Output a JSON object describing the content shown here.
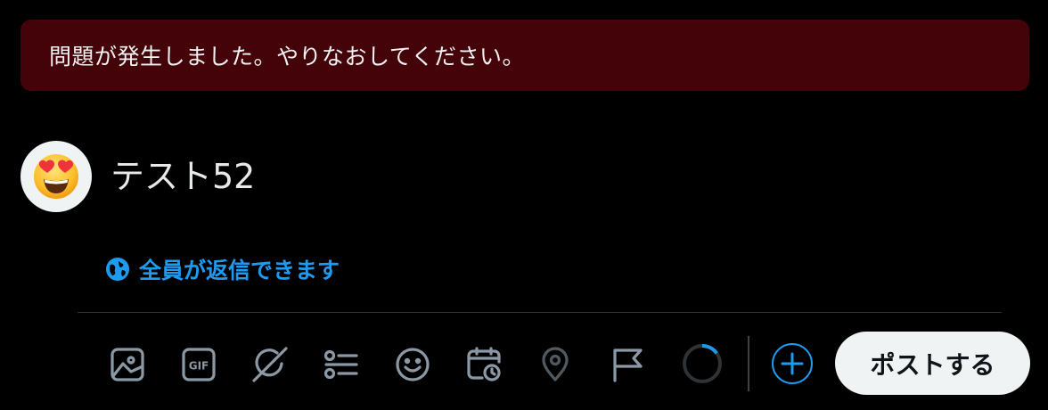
{
  "error_banner": {
    "message": "問題が発生しました。やりなおしてください。"
  },
  "composer": {
    "text": "テスト52",
    "reply_setting": "全員が返信できます",
    "post_button": "ポストする",
    "character_progress": 0.15
  },
  "toolbar": {
    "icons": [
      "media-icon",
      "gif-icon",
      "grok-icon",
      "poll-icon",
      "emoji-icon",
      "schedule-icon",
      "location-icon",
      "flag-icon"
    ]
  },
  "colors": {
    "accent": "#1d9bf0",
    "error_background": "#430309",
    "icon_gray": "#8b98a5"
  }
}
